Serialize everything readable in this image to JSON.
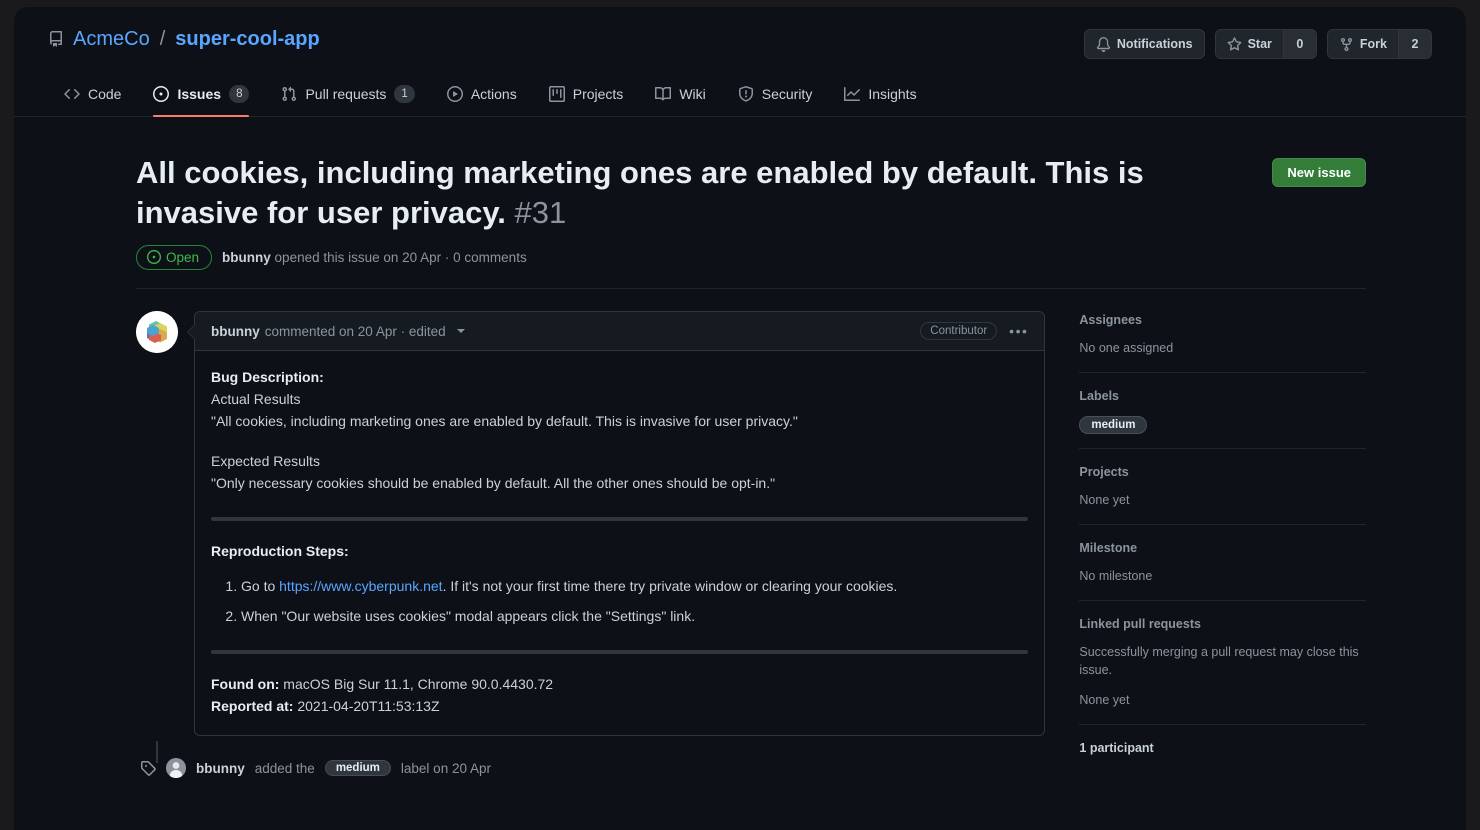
{
  "header": {
    "repo_icon": "repo-icon",
    "owner": "AcmeCo",
    "separator": "/",
    "name": "super-cool-app",
    "actions": {
      "notifications_label": "Notifications",
      "notifications_icon": "bell-icon",
      "star_label": "Star",
      "star_icon": "star-icon",
      "star_count": "0",
      "fork_label": "Fork",
      "fork_icon": "fork-icon",
      "fork_count": "2"
    }
  },
  "nav": {
    "tabs": [
      {
        "label": "Code",
        "icon": "code-icon",
        "count": null,
        "active": false
      },
      {
        "label": "Issues",
        "icon": "issue-icon",
        "count": "8",
        "active": true
      },
      {
        "label": "Pull requests",
        "icon": "pr-icon",
        "count": "1",
        "active": false
      },
      {
        "label": "Actions",
        "icon": "play-icon",
        "count": null,
        "active": false
      },
      {
        "label": "Projects",
        "icon": "project-icon",
        "count": null,
        "active": false
      },
      {
        "label": "Wiki",
        "icon": "book-icon",
        "count": null,
        "active": false
      },
      {
        "label": "Security",
        "icon": "shield-icon",
        "count": null,
        "active": false
      },
      {
        "label": "Insights",
        "icon": "graph-icon",
        "count": null,
        "active": false
      }
    ]
  },
  "issue": {
    "title": "All cookies, including marketing ones are enabled by default. This is invasive for user privacy.",
    "number": "#31",
    "new_issue_label": "New issue",
    "state": "Open",
    "state_icon": "issue-open-icon",
    "state_color": "#3fb950",
    "meta_author": "bbunny",
    "meta_text": "opened this issue on 20 Apr · 0 comments"
  },
  "comment": {
    "author": "bbunny",
    "meta": "commented on 20 Apr · edited",
    "role_badge": "Contributor",
    "kebab_icon": "kebab-horizontal-icon",
    "body": {
      "heading_bug": "Bug Description:",
      "actual_heading": "Actual Results",
      "actual_text": "\"All cookies, including marketing ones are enabled by default. This is invasive for user privacy.\"",
      "expected_heading": "Expected Results",
      "expected_text": "\"Only necessary cookies should be enabled by default. All the other ones should be opt-in.\"",
      "repro_heading": "Reproduction Steps:",
      "steps": [
        {
          "prefix": "Go to ",
          "link": "https://www.cyberpunk.net",
          "suffix": ". If it's not your first time there try private window or clearing your cookies."
        },
        {
          "prefix": "When \"Our website uses cookies\" modal appears click the \"Settings\" link.",
          "link": "",
          "suffix": ""
        }
      ],
      "found_on_label": "Found on:",
      "found_on_value": " macOS Big Sur 11.1, Chrome 90.0.4430.72",
      "reported_at_label": "Reported at:",
      "reported_at_value": " 2021-04-20T11:53:13Z"
    }
  },
  "timeline": {
    "icon": "tag-icon",
    "user": "bbunny",
    "action": "added the",
    "label": "medium",
    "suffix": "label on 20 Apr"
  },
  "sidebar": {
    "assignees": {
      "title": "Assignees",
      "value": "No one assigned"
    },
    "labels": {
      "title": "Labels",
      "value": "medium"
    },
    "projects": {
      "title": "Projects",
      "value": "None yet"
    },
    "milestone": {
      "title": "Milestone",
      "value": "No milestone"
    },
    "linked_prs": {
      "title": "Linked pull requests",
      "help": "Successfully merging a pull request may close this issue.",
      "value": "None yet"
    },
    "participants": {
      "title": "1 participant"
    }
  }
}
